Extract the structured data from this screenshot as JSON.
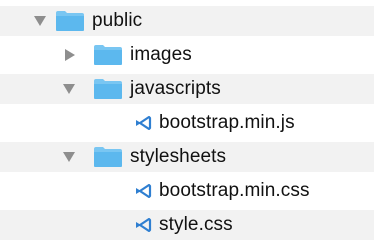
{
  "tree": {
    "rows": [
      {
        "name": "public",
        "kind": "folder",
        "state": "expanded",
        "disclosure_icon": "triangle-down-icon",
        "icon": "folder-icon"
      },
      {
        "name": "images",
        "kind": "folder",
        "state": "collapsed",
        "disclosure_icon": "triangle-right-icon",
        "icon": "folder-icon"
      },
      {
        "name": "javascripts",
        "kind": "folder",
        "state": "expanded",
        "disclosure_icon": "triangle-down-icon",
        "icon": "folder-icon"
      },
      {
        "name": "bootstrap.min.js",
        "kind": "file",
        "icon": "vscode-file-icon"
      },
      {
        "name": "stylesheets",
        "kind": "folder",
        "state": "expanded",
        "disclosure_icon": "triangle-down-icon",
        "icon": "folder-icon"
      },
      {
        "name": "bootstrap.min.css",
        "kind": "file",
        "icon": "vscode-file-icon"
      },
      {
        "name": "style.css",
        "kind": "file",
        "icon": "vscode-file-icon"
      }
    ]
  },
  "colors": {
    "folder_body": "#5cb8ee",
    "folder_tab": "#79c6f2",
    "file_icon": "#2f7fd1",
    "disclosure": "#8e8e8e",
    "stripe": "#f2f2f2",
    "text": "#111111"
  }
}
